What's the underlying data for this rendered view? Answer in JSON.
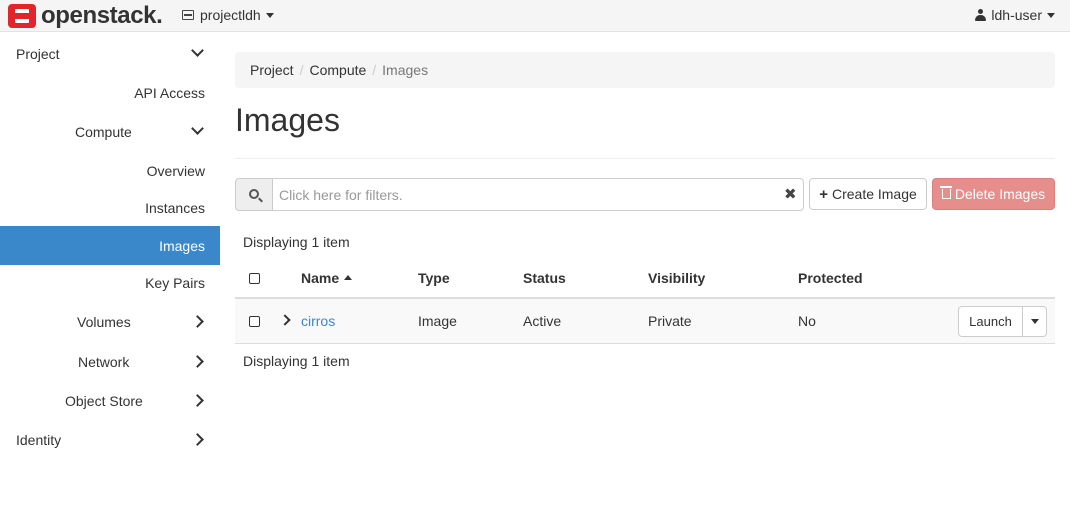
{
  "header": {
    "brand": "openstack.",
    "project": "projectldh",
    "user": "ldh-user"
  },
  "sidebar": {
    "project": "Project",
    "api_access": "API Access",
    "compute": "Compute",
    "overview": "Overview",
    "instances": "Instances",
    "images": "Images",
    "key_pairs": "Key Pairs",
    "volumes": "Volumes",
    "network": "Network",
    "object_store": "Object Store",
    "identity": "Identity"
  },
  "breadcrumb": [
    "Project",
    "Compute",
    "Images"
  ],
  "page_title": "Images",
  "filter": {
    "placeholder": "Click here for filters.",
    "clear": "✖"
  },
  "actions": {
    "create": "Create Image",
    "delete": "Delete Images"
  },
  "count_text": "Displaying 1 item",
  "table": {
    "columns": [
      "Name",
      "Type",
      "Status",
      "Visibility",
      "Protected"
    ],
    "rows": [
      {
        "name": "cirros",
        "type": "Image",
        "status": "Active",
        "visibility": "Private",
        "protected": "No",
        "action": "Launch"
      }
    ]
  },
  "colors": {
    "accent": "#3a87c9",
    "danger": "#e58e8c",
    "brand_red": "#e0262c"
  },
  "icons": [
    "server-icon",
    "user-icon",
    "search-icon",
    "plus-icon",
    "trash-icon",
    "chevron-down-icon",
    "chevron-right-icon",
    "sort-asc-icon"
  ]
}
